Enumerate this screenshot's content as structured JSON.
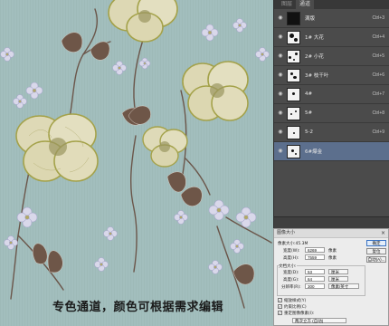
{
  "caption": "专色通道，颜色可根据需求编辑",
  "channels_panel": {
    "tabs": [
      "图层",
      "通道"
    ],
    "active_tab": "通道",
    "rows": [
      {
        "name": "满版",
        "shortcut": "Ctrl+3",
        "thumb": "black"
      },
      {
        "name": "1# 大花",
        "shortcut": "Ctrl+4",
        "thumb": "spots"
      },
      {
        "name": "2# 小花",
        "shortcut": "Ctrl+5",
        "thumb": "spots"
      },
      {
        "name": "3# 枝干叶",
        "shortcut": "Ctrl+6",
        "thumb": "spots"
      },
      {
        "name": "4#",
        "shortcut": "Ctrl+7",
        "thumb": "spots"
      },
      {
        "name": "5#",
        "shortcut": "Ctrl+8",
        "thumb": "spots"
      },
      {
        "name": "5-2",
        "shortcut": "Ctrl+9",
        "thumb": "spots"
      },
      {
        "name": "6#爆金",
        "shortcut": "",
        "thumb": "spots",
        "selected": true
      }
    ]
  },
  "image_size_dialog": {
    "title": "图像大小",
    "pixel_size_label": "像素大小:45.3M",
    "width_label": "宽度(W):",
    "width_value": "6269",
    "height_label": "高度(H):",
    "height_value": "7559",
    "unit_pixels": "像素",
    "document_size_label": "文档大小:",
    "doc_width_label": "宽度(D):",
    "doc_width_value": "53",
    "doc_height_label": "高度(G):",
    "doc_height_value": "64",
    "unit_cm": "厘米",
    "resolution_label": "分辨率(R):",
    "resolution_value": "300",
    "resolution_unit": "像素/英寸",
    "scale_styles_label": "缩放样式(Y)",
    "constrain_label": "约束比例(C)",
    "resample_label": "重定图像像素(I):",
    "resample_method": "两次立方 (自动)",
    "ok_label": "确定",
    "cancel_label": "复位",
    "auto_label": "自动(A)..."
  }
}
